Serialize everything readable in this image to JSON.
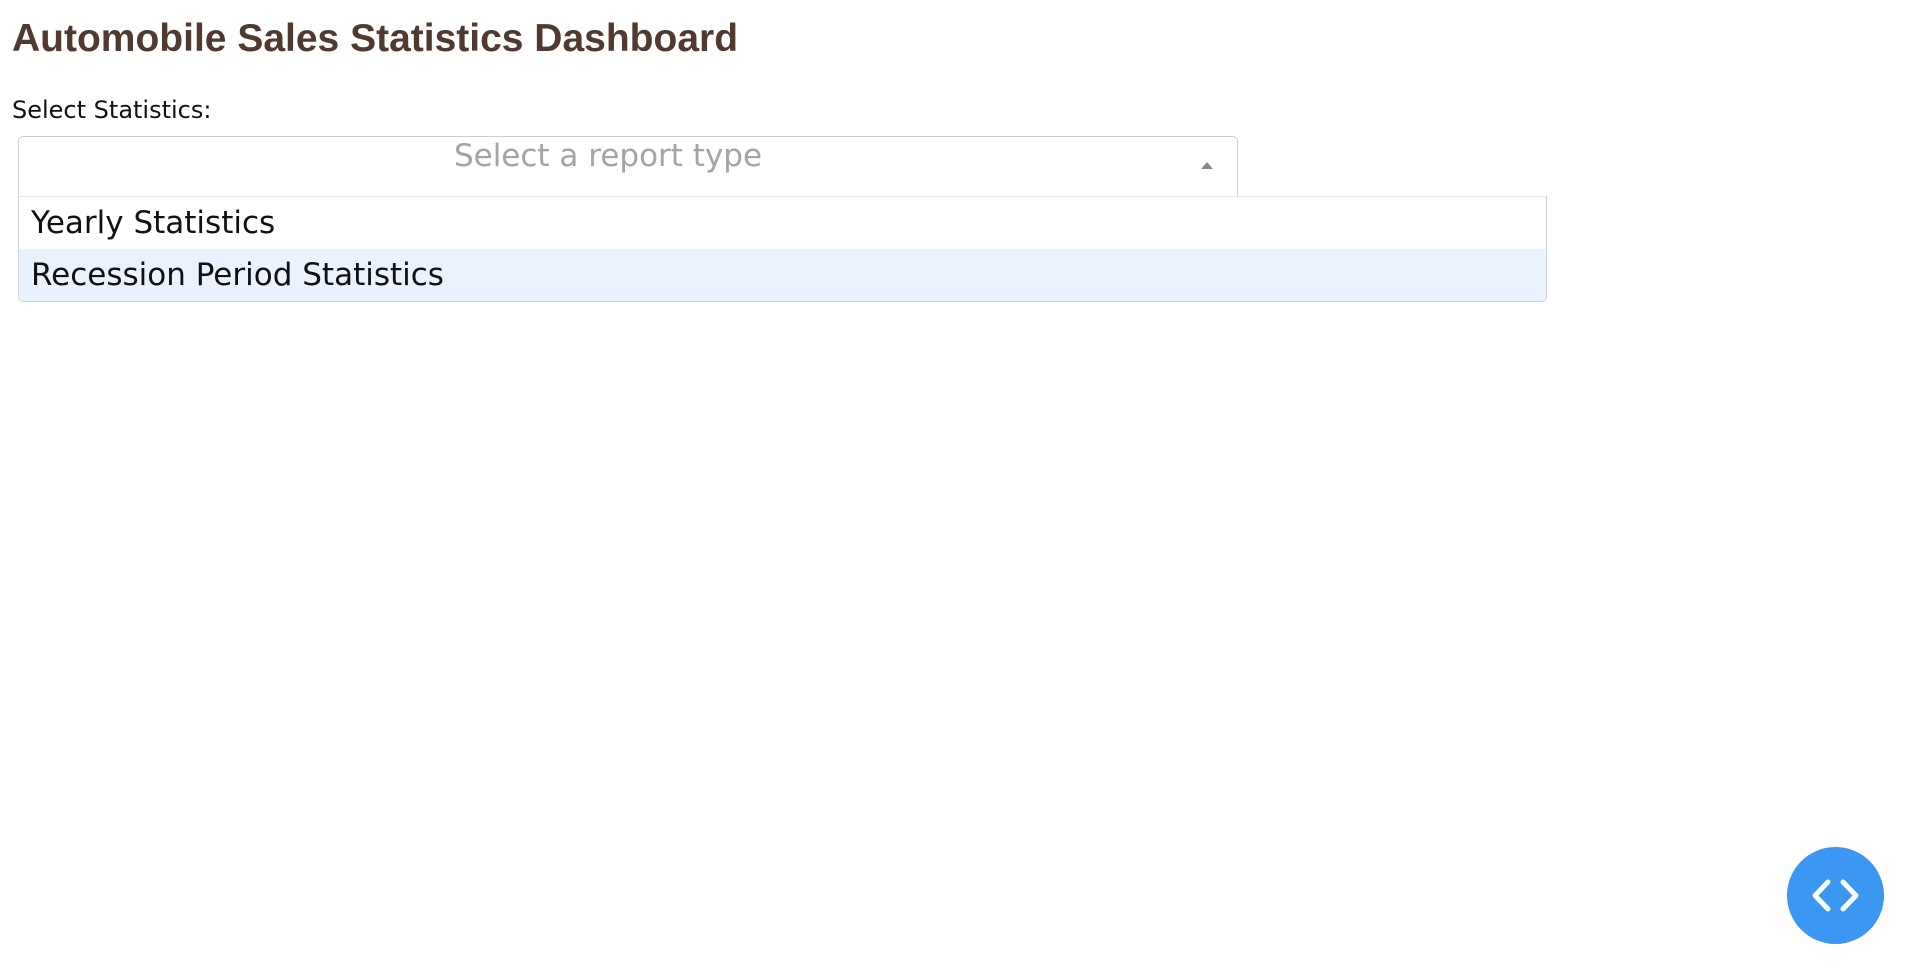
{
  "header": {
    "title": "Automobile Sales Statistics Dashboard"
  },
  "report_selector": {
    "label": "Select Statistics:",
    "placeholder": "Select a report type",
    "expanded": true,
    "options": [
      {
        "label": "Yearly Statistics",
        "focused": false
      },
      {
        "label": "Recession Period Statistics",
        "focused": true
      }
    ]
  },
  "devtools_toggle": {
    "icon": "code-brackets-icon",
    "color": "#3b97f2"
  },
  "colors": {
    "title": "#503a2f",
    "placeholder": "#a4a4a4",
    "option_focus_bg": "#eaf2fd"
  }
}
